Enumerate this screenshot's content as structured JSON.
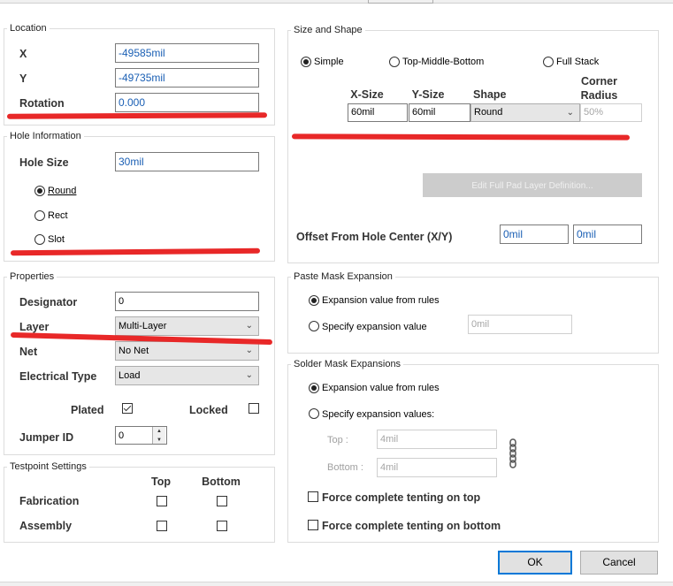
{
  "location": {
    "title": "Location",
    "x_label": "X",
    "x_value": "-49585mil",
    "y_label": "Y",
    "y_value": "-49735mil",
    "rotation_label": "Rotation",
    "rotation_value": "0.000"
  },
  "hole": {
    "title": "Hole Information",
    "size_label": "Hole Size",
    "size_value": "30mil",
    "round": "Round",
    "rect": "Rect",
    "slot": "Slot",
    "selected": "Round"
  },
  "properties": {
    "title": "Properties",
    "designator_label": "Designator",
    "designator_value": "0",
    "layer_label": "Layer",
    "layer_value": "Multi-Layer",
    "net_label": "Net",
    "net_value": "No Net",
    "etype_label": "Electrical Type",
    "etype_value": "Load",
    "plated_label": "Plated",
    "plated_checked": true,
    "locked_label": "Locked",
    "locked_checked": false,
    "jumper_label": "Jumper ID",
    "jumper_value": "0"
  },
  "testpoint": {
    "title": "Testpoint Settings",
    "col_top": "Top",
    "col_bottom": "Bottom",
    "fabrication": "Fabrication",
    "assembly": "Assembly"
  },
  "size_shape": {
    "title": "Size and Shape",
    "simple": "Simple",
    "tmb": "Top-Middle-Bottom",
    "full_stack": "Full Stack",
    "selected": "Simple",
    "col_xsize": "X-Size",
    "col_ysize": "Y-Size",
    "col_shape": "Shape",
    "col_corner_1": "Corner",
    "col_corner_2": "Radius",
    "xsize_value": "60mil",
    "ysize_value": "60mil",
    "shape_value": "Round",
    "corner_value": "50%",
    "edit_button": "Edit Full Pad Layer Definition...",
    "offset_label": "Offset From Hole Center (X/Y)",
    "offset_x": "0mil",
    "offset_y": "0mil"
  },
  "paste_mask": {
    "title": "Paste Mask Expansion",
    "from_rules": "Expansion value from rules",
    "specify": "Specify expansion value",
    "value": "0mil"
  },
  "solder_mask": {
    "title": "Solder Mask Expansions",
    "from_rules": "Expansion value from rules",
    "specify": "Specify expansion values:",
    "top_label": "Top :",
    "top_value": "4mil",
    "bottom_label": "Bottom :",
    "bottom_value": "4mil",
    "force_top": "Force complete tenting on top",
    "force_bottom": "Force complete tenting on bottom"
  },
  "buttons": {
    "ok": "OK",
    "cancel": "Cancel"
  },
  "colors": {
    "annotation": "#e82828",
    "accent": "#0078d7",
    "value_text": "#1a5fb4"
  },
  "icons": {
    "link": "chain-link-icon",
    "dropdown": "chevron-down-icon"
  }
}
